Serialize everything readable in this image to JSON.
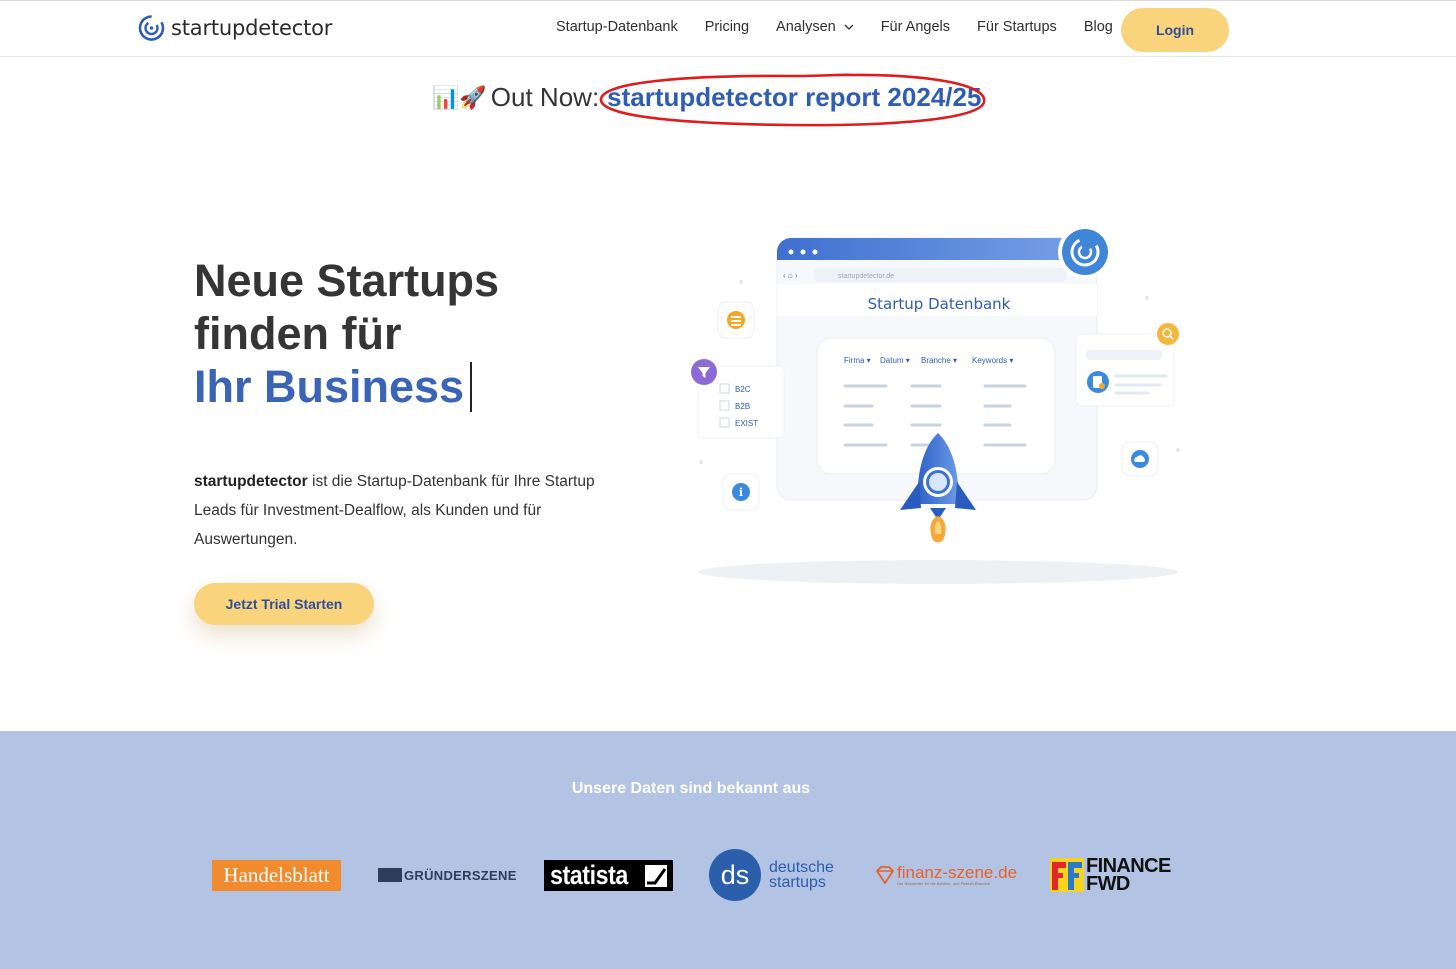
{
  "header": {
    "logo_text": "startupdetector",
    "nav": [
      {
        "label": "Startup-Datenbank"
      },
      {
        "label": "Pricing"
      },
      {
        "label": "Analysen",
        "has_dropdown": true
      },
      {
        "label": "Für Angels"
      },
      {
        "label": "Für Startups"
      },
      {
        "label": "Blog"
      }
    ],
    "login_label": "Login"
  },
  "announcement": {
    "emoji": "📊🚀",
    "prefix": "Out Now:",
    "link_text": "startupdetector report 2024/25"
  },
  "hero": {
    "title_line1": "Neue Startups",
    "title_line2": "finden für",
    "title_line3": "Ihr Business",
    "desc_bold": "startupdetector",
    "desc_rest": " ist die Startup-Datenbank für Ihre Startup Leads für Investment-Dealflow, als Kunden und für Auswertungen.",
    "cta_label": "Jetzt Trial Starten"
  },
  "illustration": {
    "url_text": "startupdetector.de",
    "heading": "Startup Datenbank",
    "filters": [
      "Firma ▾",
      "Datum ▾",
      "Branche ▾",
      "Keywords ▾"
    ],
    "checkboxes": [
      "B2C",
      "B2B",
      "EXIST"
    ]
  },
  "press": {
    "title": "Unsere Daten sind bekannt aus",
    "logos": {
      "handelsblatt": "Handelsblatt",
      "gruenderszene": "GRÜNDERSZENE",
      "statista": "statista",
      "ds_mark": "ds",
      "ds_line1": "deutsche",
      "ds_line2": "startups",
      "finanz": "finanz-szene.de",
      "finanz_tagline": "Der Newsletter für die Banken- und Fintech-Branche",
      "financefwd_line1": "FINANCE",
      "financefwd_line2": "FWD"
    }
  },
  "colors": {
    "brand_blue": "#3a65b6",
    "cta_yellow": "#fad47c",
    "band_blue": "#b2c3e4",
    "annotation_red": "#e01b1b"
  }
}
